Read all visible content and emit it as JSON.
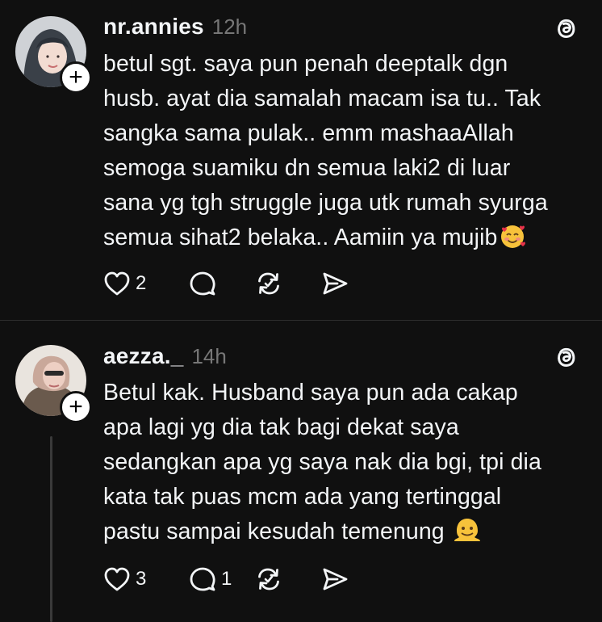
{
  "posts": [
    {
      "username": "nr.annies",
      "time": "12h",
      "text": "betul sgt. saya pun penah deeptalk dgn\nhusb. ayat dia samalah macam isa tu.. Tak\nsangka sama pulak.. emm mashaaAllah\nsemoga suamiku dn semua laki2 di luar\nsana yg tgh struggle juga utk rumah syurga\nsemua sihat2 belaka.. Aamiin ya mujib",
      "emoji": "smiling-face-with-hearts",
      "likes": "2",
      "replies": "",
      "follow_label": "+"
    },
    {
      "username": "aezza._",
      "time": "14h",
      "text": "Betul kak. Husband saya pun ada cakap\napa lagi yg dia tak bagi dekat saya\nsedangkan apa yg saya nak dia bgi, tpi dia\nkata tak puas mcm ada yang tertinggal\npastu sampai kesudah temenung",
      "emoji": "melting-face",
      "likes": "3",
      "replies": "1",
      "follow_label": "+"
    }
  ],
  "colors": {
    "background": "#101010",
    "text": "#f3f5f7",
    "muted": "#777777",
    "divider": "#2e2e2e"
  },
  "icons": [
    "heart-icon",
    "comment-icon",
    "repost-icon",
    "share-icon",
    "threads-logo-icon",
    "follow-plus-icon"
  ]
}
